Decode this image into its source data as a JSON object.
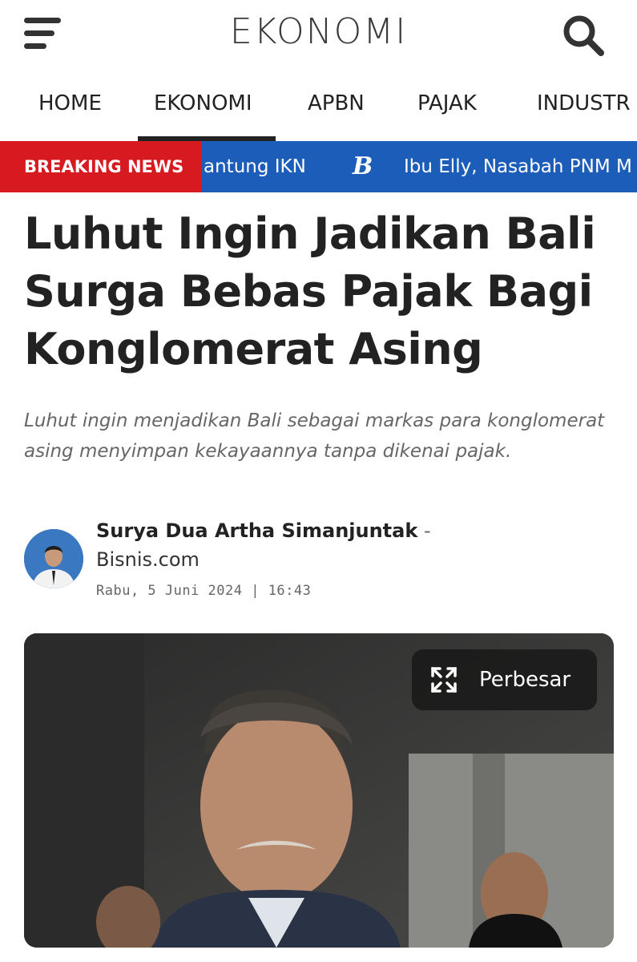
{
  "header": {
    "brand": "EKONOMI",
    "menu_icon": "hamburger-menu-icon",
    "search_icon": "search-icon"
  },
  "nav": {
    "items": [
      {
        "label": "HOME"
      },
      {
        "label": "EKONOMI",
        "active": true
      },
      {
        "label": "APBN"
      },
      {
        "label": "PAJAK"
      },
      {
        "label": "INDUSTR"
      }
    ]
  },
  "breaking": {
    "label": "BREAKING NEWS",
    "ticker_1": "antung IKN",
    "ticker_logo": "B",
    "ticker_2": "Ibu Elly, Nasabah PNM M",
    "colors": {
      "label_bg": "#d71920",
      "bar_bg": "#1b5db8"
    }
  },
  "article": {
    "title": "Luhut Ingin Jadikan Bali Surga Bebas Pajak Bagi Konglomerat Asing",
    "summary": "Luhut ingin menjadikan Bali sebagai markas para konglomerat asing menyimpan kekayaannya tanpa dikenai pajak.",
    "author": "Surya Dua Artha Simanjuntak",
    "author_separator": " - ",
    "source": "Bisnis.com",
    "date": "Rabu, 5 Juni 2024 | 16:43",
    "zoom_label": "Perbesar",
    "zoom_icon": "expand-arrows-icon"
  }
}
